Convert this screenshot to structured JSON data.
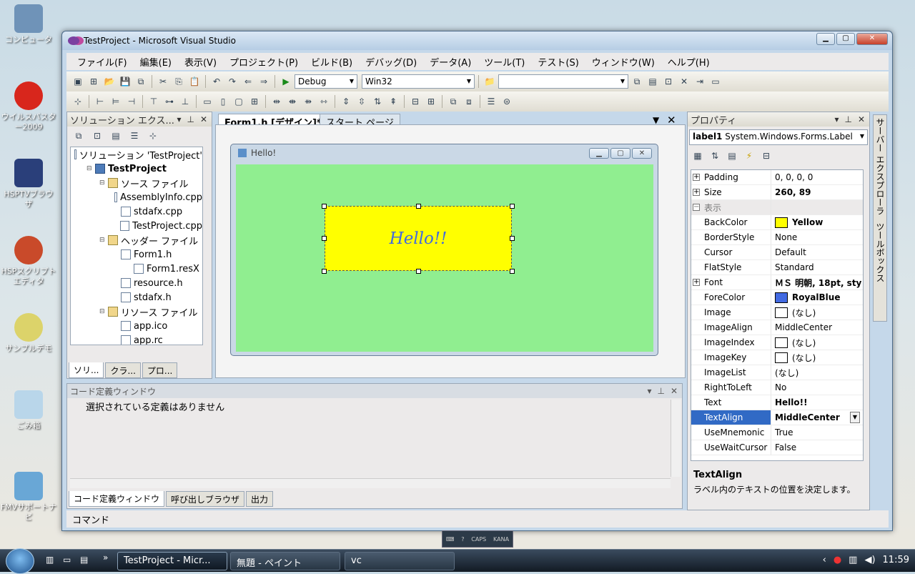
{
  "desktop": {
    "icons": [
      "コンピュータ",
      "ウイルスバスター2009",
      "HSPTVブラウザ",
      "HSPスクリプトエディタ",
      "サンプルデモ",
      "ごみ箱",
      "FMVサポートナビ"
    ]
  },
  "window": {
    "title": "TestProject - Microsoft Visual Studio",
    "menu": [
      "ファイル(F)",
      "編集(E)",
      "表示(V)",
      "プロジェクト(P)",
      "ビルド(B)",
      "デバッグ(D)",
      "データ(A)",
      "ツール(T)",
      "テスト(S)",
      "ウィンドウ(W)",
      "ヘルプ(H)"
    ],
    "toolbar": {
      "config": "Debug",
      "platform": "Win32",
      "find": ""
    }
  },
  "solution_explorer": {
    "title": "ソリューション エクス...",
    "tree": [
      {
        "label": "ソリューション 'TestProject'",
        "level": 0,
        "kind": "file"
      },
      {
        "label": "TestProject",
        "level": 1,
        "kind": "proj"
      },
      {
        "label": "ソース ファイル",
        "level": 2,
        "kind": "folder"
      },
      {
        "label": "AssemblyInfo.cpp",
        "level": 3,
        "kind": "file"
      },
      {
        "label": "stdafx.cpp",
        "level": 3,
        "kind": "file"
      },
      {
        "label": "TestProject.cpp",
        "level": 3,
        "kind": "file"
      },
      {
        "label": "ヘッダー ファイル",
        "level": 2,
        "kind": "folder"
      },
      {
        "label": "Form1.h",
        "level": 3,
        "kind": "file"
      },
      {
        "label": "Form1.resX",
        "level": 4,
        "kind": "file"
      },
      {
        "label": "resource.h",
        "level": 3,
        "kind": "file"
      },
      {
        "label": "stdafx.h",
        "level": 3,
        "kind": "file"
      },
      {
        "label": "リソース ファイル",
        "level": 2,
        "kind": "folder"
      },
      {
        "label": "app.ico",
        "level": 3,
        "kind": "file"
      },
      {
        "label": "app.rc",
        "level": 3,
        "kind": "file"
      }
    ],
    "tabs": [
      "ソリ...",
      "クラ...",
      "プロ..."
    ]
  },
  "editor": {
    "tabs": [
      "Form1.h [デザイン]*",
      "スタート ページ"
    ],
    "form_title": "Hello!",
    "label_text": "Hello!!"
  },
  "code_def": {
    "title": "コード定義ウィンドウ",
    "message": "選択されている定義はありません",
    "tabs": [
      "コード定義ウィンドウ",
      "呼び出しブラウザ",
      "出力"
    ]
  },
  "command": {
    "label": "コマンド"
  },
  "properties": {
    "title": "プロパティ",
    "object_name": "label1",
    "object_type": "System.Windows.Forms.Label",
    "rows": [
      {
        "name": "Padding",
        "value": "0, 0, 0, 0",
        "exp": true
      },
      {
        "name": "Size",
        "value": "260, 89",
        "exp": true,
        "bold": true
      },
      {
        "name": "表示",
        "value": "",
        "cat": true
      },
      {
        "name": "BackColor",
        "value": "Yellow",
        "bold": true,
        "swatch": "#ffff00"
      },
      {
        "name": "BorderStyle",
        "value": "None"
      },
      {
        "name": "Cursor",
        "value": "Default"
      },
      {
        "name": "FlatStyle",
        "value": "Standard"
      },
      {
        "name": "Font",
        "value": "ＭＳ 明朝, 18pt, sty",
        "exp": true,
        "bold": true
      },
      {
        "name": "ForeColor",
        "value": "RoyalBlue",
        "bold": true,
        "swatch": "#4169e1"
      },
      {
        "name": "Image",
        "value": "(なし)",
        "swatch": "#ffffff"
      },
      {
        "name": "ImageAlign",
        "value": "MiddleCenter"
      },
      {
        "name": "ImageIndex",
        "value": "(なし)",
        "swatch": "#ffffff"
      },
      {
        "name": "ImageKey",
        "value": "(なし)",
        "swatch": "#ffffff"
      },
      {
        "name": "ImageList",
        "value": "(なし)"
      },
      {
        "name": "RightToLeft",
        "value": "No"
      },
      {
        "name": "Text",
        "value": "Hello!!",
        "bold": true
      },
      {
        "name": "TextAlign",
        "value": "MiddleCenter",
        "bold": true,
        "sel": true
      },
      {
        "name": "UseMnemonic",
        "value": "True"
      },
      {
        "name": "UseWaitCursor",
        "value": "False"
      }
    ],
    "desc_title": "TextAlign",
    "desc_text": "ラベル内のテキストの位置を決定します。"
  },
  "side_tabs": [
    "サーバー エクスプローラ",
    "ツールボックス"
  ],
  "taskbar": {
    "items": [
      "TestProject - Micr...",
      "無題 - ペイント",
      "vc"
    ],
    "clock": "11:59",
    "ime": [
      "CAPS",
      "KANA"
    ]
  }
}
